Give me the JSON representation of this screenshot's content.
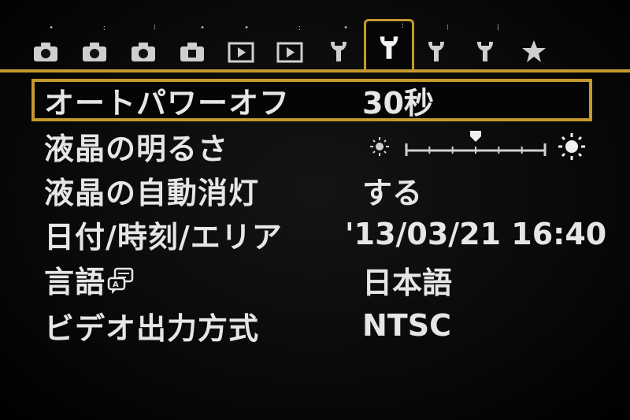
{
  "tabs": [
    {
      "name": "shooting-1",
      "icon": "camera-icon",
      "dots": "•"
    },
    {
      "name": "shooting-2",
      "icon": "camera-icon",
      "dots": "••"
    },
    {
      "name": "shooting-3",
      "icon": "camera-icon",
      "dots": "•••"
    },
    {
      "name": "shooting-4",
      "icon": "camera-icon",
      "dots": "••••"
    },
    {
      "name": "playback-1",
      "icon": "play-icon",
      "dots": "•"
    },
    {
      "name": "playback-2",
      "icon": "play-icon",
      "dots": "••"
    },
    {
      "name": "setup-1",
      "icon": "wrench-icon",
      "dots": "•"
    },
    {
      "name": "setup-2",
      "icon": "wrench-icon",
      "dots": "••",
      "active": true
    },
    {
      "name": "setup-3",
      "icon": "wrench-icon",
      "dots": "•••"
    },
    {
      "name": "setup-4",
      "icon": "wrench-icon",
      "dots": "••••"
    },
    {
      "name": "my-menu",
      "icon": "star-icon",
      "dots": ""
    }
  ],
  "menu": {
    "auto_power_off": {
      "label": "オートパワーオフ",
      "value": "30秒"
    },
    "lcd_brightness": {
      "label": "液晶の明るさ",
      "level": 4,
      "max": 7
    },
    "lcd_auto_off": {
      "label": "液晶の自動消灯",
      "value": "する"
    },
    "date_time": {
      "label": "日付/時刻/エリア",
      "value": "'13/03/21 16:40"
    },
    "language": {
      "label": "言語",
      "icon": "speech-bubble-icon",
      "value": "日本語"
    },
    "video_system": {
      "label": "ビデオ出力方式",
      "value": "NTSC"
    }
  },
  "colors": {
    "accent": "#c49a2c",
    "text": "#e6e6e6",
    "icon": "#cfcfcf",
    "background": "#000000"
  }
}
